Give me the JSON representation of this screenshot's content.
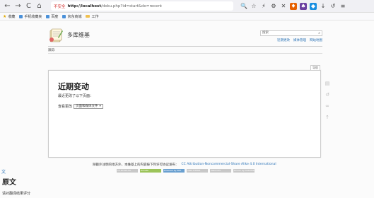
{
  "browser": {
    "back_icon": "←",
    "forward_icon": "→",
    "reload_icon": "C",
    "home_icon": "⌂",
    "url_warning": "不安全",
    "url_host": "http://localhost",
    "url_path": "/doku.php?id=start&do=recent",
    "bookmarks": [
      "收藏",
      "手机收藏夹",
      "百度",
      "京东商城",
      "工作"
    ]
  },
  "wiki": {
    "site_title": "多库维基",
    "search_placeholder": "搜索",
    "user_links": [
      "近期更改",
      "媒体管理",
      "网站地图"
    ],
    "breadcrumb": "跟踪:",
    "content_tag": "导航",
    "page_title": "近期变动",
    "description": "最近更改了以下页面：",
    "filter_label": "查看更改",
    "filter_value": "页面和媒体文件"
  },
  "footer": {
    "text": "除额外注明的地方外，本维基上的内容按下列许可协议发布：",
    "license": "CC Attribution-Noncommercial-Share Alike 4.0 International",
    "badges": [
      "CC BY-NC-SA",
      "Donate",
      "Powered by PHP",
      "Valid HTML5",
      "Valid CSS",
      "Driven by DokuWiki"
    ]
  },
  "translate": {
    "title": "原文",
    "text": "请对翻译结果评分"
  }
}
